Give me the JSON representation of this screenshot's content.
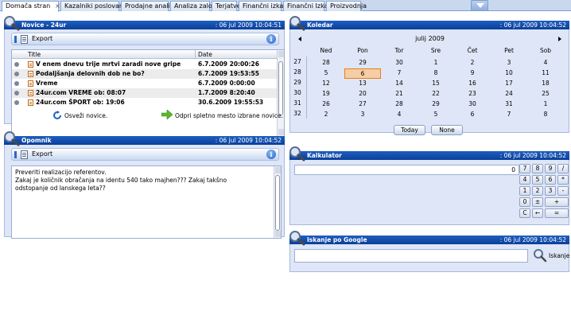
{
  "tabs": [
    {
      "label": "Domača stran",
      "closable": true,
      "active": true
    },
    {
      "label": "Kazalniki poslovanja"
    },
    {
      "label": "Prodajne analize"
    },
    {
      "label": "Analiza zalog"
    },
    {
      "label": "Terjatve"
    },
    {
      "label": "Finančni izkazi"
    },
    {
      "label": "Finančni Izkazi"
    },
    {
      "label": "Proizvodnja"
    }
  ],
  "tab_close_glyph": "×",
  "news": {
    "title": "Novice - 24ur",
    "timestamp": ": 06 jul 2009 10:04:51",
    "export_label": "Export",
    "info_glyph": "i",
    "columns": [
      "Title",
      "Date"
    ],
    "rows": [
      {
        "title": "V enem dnevu trije mrtvi zaradi nove gripe",
        "date": "6.7.2009 20:00:26"
      },
      {
        "title": "Podaljšanja delovnih dob ne bo?",
        "date": "6.7.2009 19:53:55"
      },
      {
        "title": "Vreme",
        "date": "6.7.2009 0:00:00"
      },
      {
        "title": "24ur.com VREME ob: 08:07",
        "date": "1.7.2009 8:20:40"
      },
      {
        "title": "24ur.com ŠPORT ob: 19:06",
        "date": "30.6.2009 19:55:53"
      }
    ],
    "refresh_label": "Osveži novice.",
    "open_label": "Odpri spletno mesto izbrane novice."
  },
  "notes": {
    "title": "Opomnik",
    "timestamp": ": 06 jul 2009 10:04:52",
    "export_label": "Export",
    "info_glyph": "i",
    "lines": [
      "Preveriti realizacijo referentov.",
      "Zakaj je količnik obračanja na identu 540 tako majhen??? Zakaj takšno",
      "odstopanje od lanskega leta??"
    ]
  },
  "calendar": {
    "title": "Koledar",
    "timestamp": ": 06 jul 2009 10:04:52",
    "month_label": "julij 2009",
    "day_names": [
      "Ned",
      "Pon",
      "Tor",
      "Sre",
      "Čet",
      "Pet",
      "Sob"
    ],
    "weeks": [
      {
        "wk": "27",
        "days": [
          "28",
          "29",
          "30",
          "1",
          "2",
          "3",
          "4"
        ]
      },
      {
        "wk": "28",
        "days": [
          "5",
          "6",
          "7",
          "8",
          "9",
          "10",
          "11"
        ]
      },
      {
        "wk": "29",
        "days": [
          "12",
          "13",
          "14",
          "15",
          "16",
          "17",
          "18"
        ]
      },
      {
        "wk": "30",
        "days": [
          "19",
          "20",
          "21",
          "22",
          "23",
          "24",
          "25"
        ]
      },
      {
        "wk": "31",
        "days": [
          "26",
          "27",
          "28",
          "29",
          "30",
          "31",
          "1"
        ]
      },
      {
        "wk": "32",
        "days": [
          "2",
          "3",
          "4",
          "5",
          "6",
          "7",
          "8"
        ]
      }
    ],
    "selected_day": "6",
    "today_label": "Today",
    "none_label": "None"
  },
  "calculator": {
    "title": "Kalkulator",
    "timestamp": ": 06 jul 2009 10:04:52",
    "display": "0",
    "keys": [
      [
        "7",
        "8",
        "9",
        "/"
      ],
      [
        "4",
        "5",
        "6",
        "*"
      ],
      [
        "1",
        "2",
        "3",
        "-"
      ],
      [
        "0",
        "±",
        "+"
      ],
      [
        "C",
        "←",
        "="
      ]
    ]
  },
  "google": {
    "title": "Iskanje po Google",
    "timestamp": ": 06 jul 2009 10:04:52",
    "search_value": "",
    "search_label": "Iskanje"
  },
  "colors": {
    "header_blue": "#0a3f9a",
    "panel_bg": "#dfe6f7",
    "today_highlight": "#f7cda6"
  }
}
